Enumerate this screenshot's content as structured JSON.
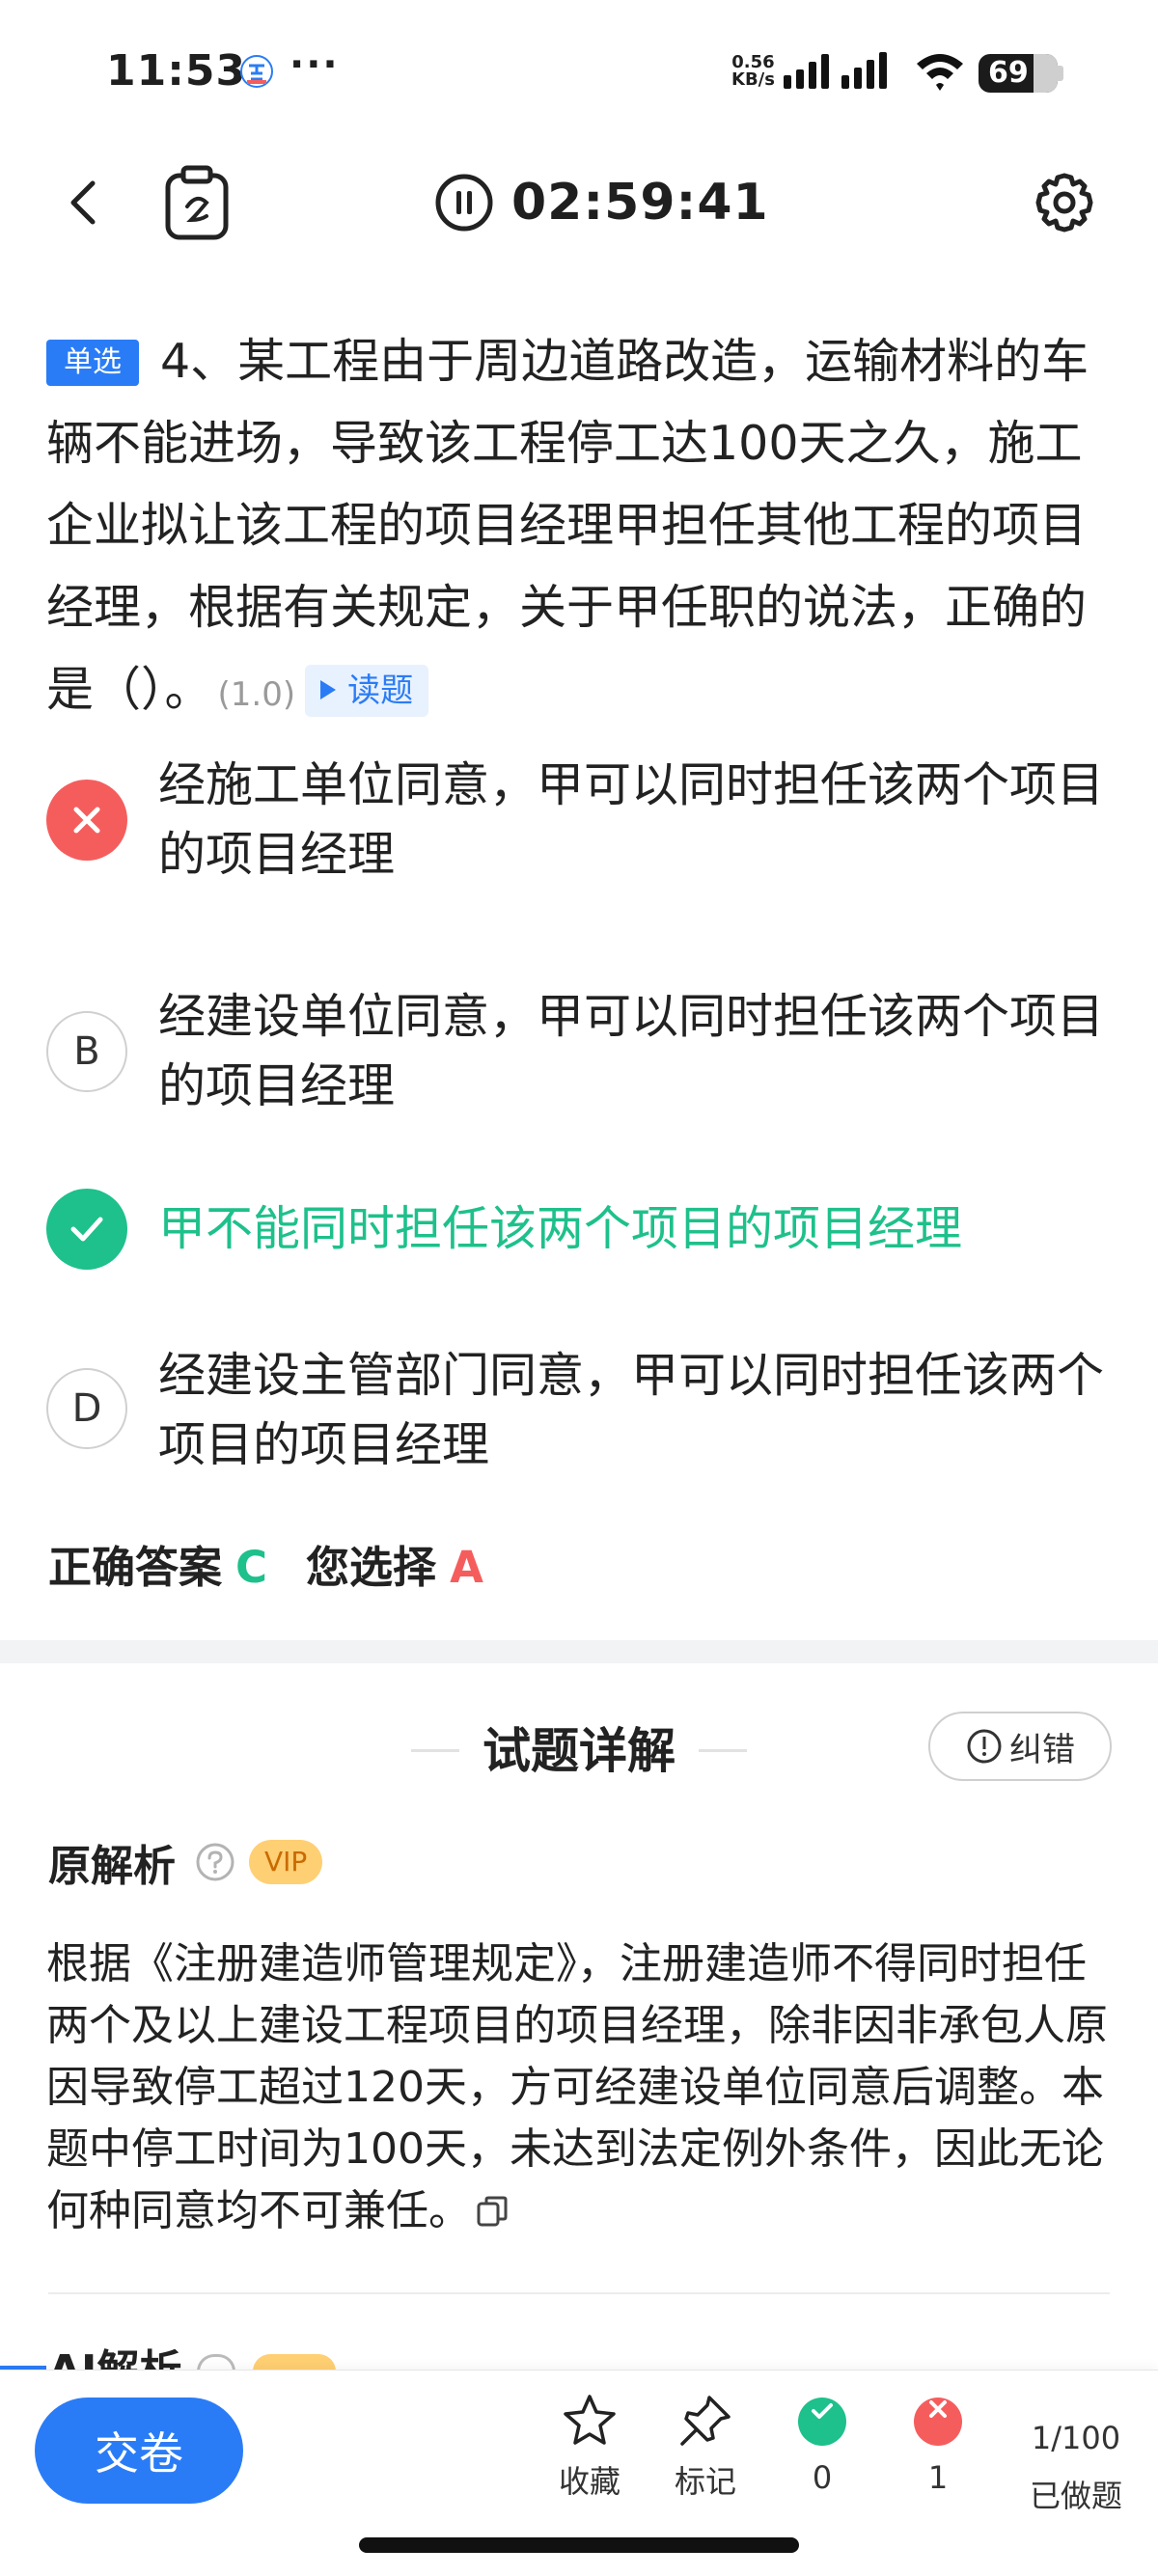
{
  "status_bar": {
    "time": "11:53",
    "dots": "···",
    "net_speed_value": "0.56",
    "net_speed_unit": "KB/s",
    "battery": "69",
    "battery_level": 0.69
  },
  "nav": {
    "timer": "02:59:41"
  },
  "question": {
    "type_tag": "单选",
    "text": "4、某工程由于周边道路改造，运输材料的车辆不能进场，导致该工程停工达100天之久，施工企业拟让该工程的项目经理甲担任其他工程的项目经理，根据有关规定，关于甲任职的说法，正确的是（）。",
    "score": "(1.0)",
    "read_label": "读题"
  },
  "options": [
    {
      "letter": "A",
      "text": "经施工单位同意，甲可以同时担任该两个项目的项目经理",
      "state": "wrong"
    },
    {
      "letter": "B",
      "text": "经建设单位同意，甲可以同时担任该两个项目的项目经理",
      "state": "normal"
    },
    {
      "letter": "C",
      "text": "甲不能同时担任该两个项目的项目经理",
      "state": "correct"
    },
    {
      "letter": "D",
      "text": "经建设主管部门同意，甲可以同时担任该两个项目的项目经理",
      "state": "normal"
    }
  ],
  "answer": {
    "correct_label": "正确答案",
    "correct_value": "C",
    "chosen_label": "您选择",
    "chosen_value": "A"
  },
  "explanation": {
    "title": "试题详解",
    "report_label": "纠错",
    "original_label": "原解析",
    "vip_label": "VIP",
    "text": "根据《注册建造师管理规定》，注册建造师不得同时担任两个及以上建设工程项目的项目经理，除非因非承包人原因导致停工超过120天，方可经建设单位同意后调整。本题中停工时间为100天，未达到法定例外条件，因此无论何种同意均不可兼任。",
    "ai_label": "AI解析"
  },
  "bottom_bar": {
    "submit_label": "交卷",
    "favorite_label": "收藏",
    "mark_label": "标记",
    "correct_count": "0",
    "wrong_count": "1",
    "progress": "1/100",
    "done_label": "已做题"
  },
  "colors": {
    "primary": "#2a7cf6",
    "correct": "#1ec08b",
    "wrong": "#f55d5d",
    "vip": "#ffcf73"
  }
}
